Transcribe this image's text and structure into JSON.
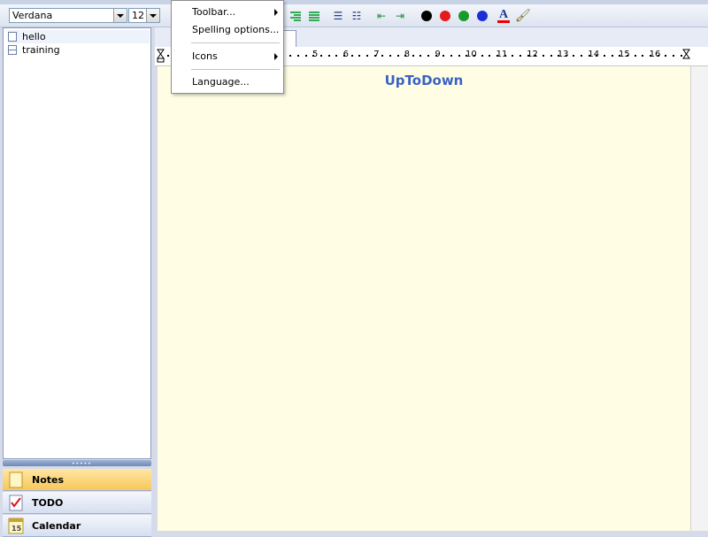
{
  "toolbar": {
    "font_name": "Verdana",
    "font_size": "12",
    "colors": [
      "#000000",
      "#e31b1b",
      "#1a9a2a",
      "#1b2fd6"
    ],
    "icons": [
      "align-right-icon",
      "align-justify-icon",
      "bullet-list-icon",
      "numbered-list-icon",
      "indent-decrease-icon",
      "indent-increase-icon",
      "font-color-icon",
      "highlight-brush-icon"
    ]
  },
  "tree": {
    "items": [
      {
        "label": "hello",
        "icon": "note-icon"
      },
      {
        "label": "training",
        "icon": "table-icon"
      }
    ]
  },
  "nav": {
    "notes": "Notes",
    "todo": "TODO",
    "calendar": "Calendar",
    "calendar_day": "15"
  },
  "menu": {
    "items": [
      {
        "label": "Toolbar...",
        "submenu": true
      },
      {
        "label": "Spelling options...",
        "submenu": false
      },
      {
        "label": "Icons",
        "submenu": true
      },
      {
        "label": "Language...",
        "submenu": false
      }
    ]
  },
  "ruler": {
    "numbers": [
      "5",
      "6",
      "7",
      "8",
      "9",
      "10",
      "11",
      "12",
      "13",
      "14",
      "15",
      "16"
    ]
  },
  "document": {
    "title": "UpToDown"
  }
}
